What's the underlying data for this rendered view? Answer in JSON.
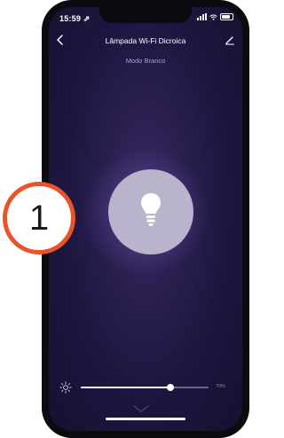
{
  "status_bar": {
    "time": "15:59 ⇗"
  },
  "header": {
    "title": "Lâmpada Wi-Fi Dicroica",
    "back_icon": "chevron-left-icon",
    "edit_icon": "pencil-icon"
  },
  "mode": {
    "label": "Modo Branco"
  },
  "lamp": {
    "icon": "lightbulb-icon",
    "button_color": "#b9b4cc"
  },
  "brightness": {
    "value": 0.7,
    "label": "70%"
  },
  "callout": {
    "number": "1",
    "color": "#e8532a"
  },
  "colors": {
    "background": "#1c1740",
    "accent": "#ffffff"
  }
}
